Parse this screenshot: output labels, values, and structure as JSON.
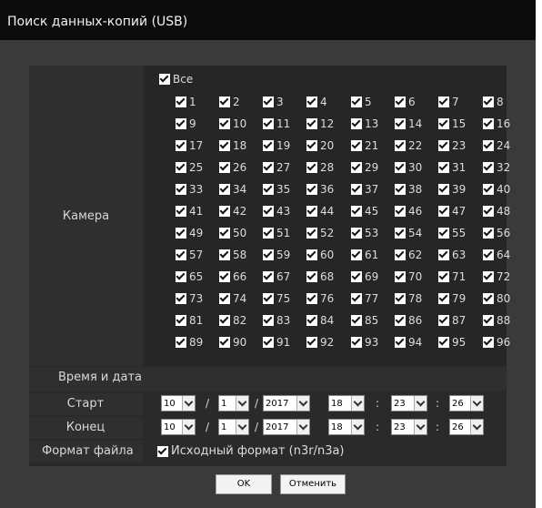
{
  "window": {
    "title": "Поиск данных-копий (USB)"
  },
  "camera": {
    "label": "Камера",
    "all_label": "Все",
    "cameras": [
      "1",
      "2",
      "3",
      "4",
      "5",
      "6",
      "7",
      "8",
      "9",
      "10",
      "11",
      "12",
      "13",
      "14",
      "15",
      "16",
      "17",
      "18",
      "19",
      "20",
      "21",
      "22",
      "23",
      "24",
      "25",
      "26",
      "27",
      "28",
      "29",
      "30",
      "31",
      "32",
      "33",
      "34",
      "35",
      "36",
      "37",
      "38",
      "39",
      "40",
      "41",
      "42",
      "43",
      "44",
      "45",
      "46",
      "47",
      "48",
      "49",
      "50",
      "51",
      "52",
      "53",
      "54",
      "55",
      "56",
      "57",
      "58",
      "59",
      "60",
      "61",
      "62",
      "63",
      "64",
      "65",
      "66",
      "67",
      "68",
      "69",
      "70",
      "71",
      "72",
      "73",
      "74",
      "75",
      "76",
      "77",
      "78",
      "79",
      "80",
      "81",
      "82",
      "83",
      "84",
      "85",
      "86",
      "87",
      "88",
      "89",
      "90",
      "91",
      "92",
      "93",
      "94",
      "95",
      "96"
    ]
  },
  "datetime": {
    "section_label": "Время и дата",
    "start": {
      "label": "Старт",
      "month": "10",
      "day": "1",
      "year": "2017",
      "hour": "18",
      "minute": "23",
      "second": "26"
    },
    "end": {
      "label": "Конец",
      "month": "10",
      "day": "1",
      "year": "2017",
      "hour": "18",
      "minute": "23",
      "second": "26"
    },
    "date_sep": "/",
    "time_sep": ":"
  },
  "format": {
    "label": "Формат файла",
    "option_label": "Исходный формат (n3r/n3a)"
  },
  "buttons": {
    "ok": "OK",
    "cancel": "Отменить"
  }
}
